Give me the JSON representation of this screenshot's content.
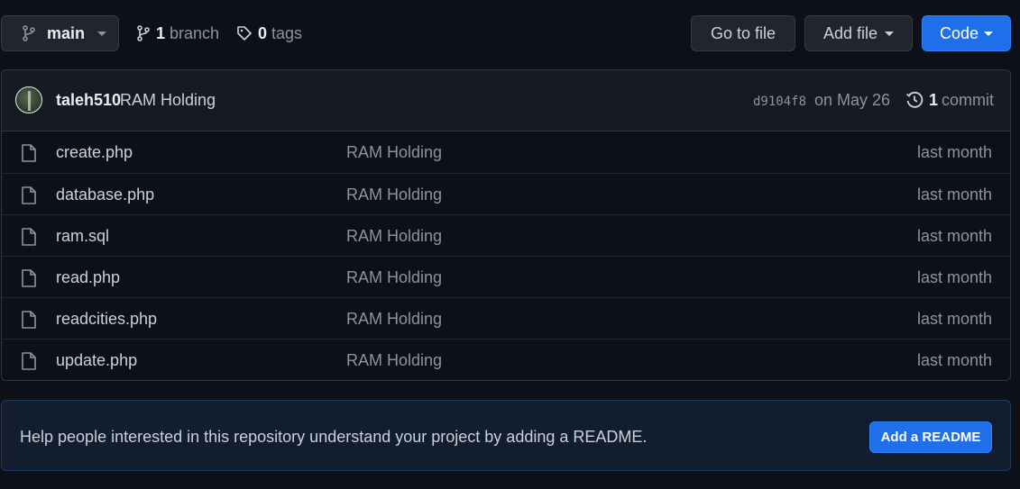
{
  "toolbar": {
    "branch_name": "main",
    "branch_count": "1",
    "branch_label": "branch",
    "tag_count": "0",
    "tag_label": "tags",
    "goto_file_label": "Go to file",
    "add_file_label": "Add file",
    "code_label": "Code"
  },
  "commit": {
    "author": "taleh510",
    "message": "RAM Holding",
    "sha": "d9104f8",
    "date": "on May 26",
    "count": "1",
    "count_label": "commit"
  },
  "files": [
    {
      "name": "create.php",
      "commit": "RAM Holding",
      "age": "last month"
    },
    {
      "name": "database.php",
      "commit": "RAM Holding",
      "age": "last month"
    },
    {
      "name": "ram.sql",
      "commit": "RAM Holding",
      "age": "last month"
    },
    {
      "name": "read.php",
      "commit": "RAM Holding",
      "age": "last month"
    },
    {
      "name": "readcities.php",
      "commit": "RAM Holding",
      "age": "last month"
    },
    {
      "name": "update.php",
      "commit": "RAM Holding",
      "age": "last month"
    }
  ],
  "readme": {
    "message": "Help people interested in this repository understand your project by adding a README.",
    "button_label": "Add a README"
  },
  "colors": {
    "background": "#0d1117",
    "accent_blue": "#1f6feb",
    "border": "#30363d",
    "muted_text": "#8b949e"
  },
  "icons": {
    "branch": "git-branch-icon",
    "tag": "tag-icon",
    "history": "history-icon",
    "file": "file-icon"
  }
}
